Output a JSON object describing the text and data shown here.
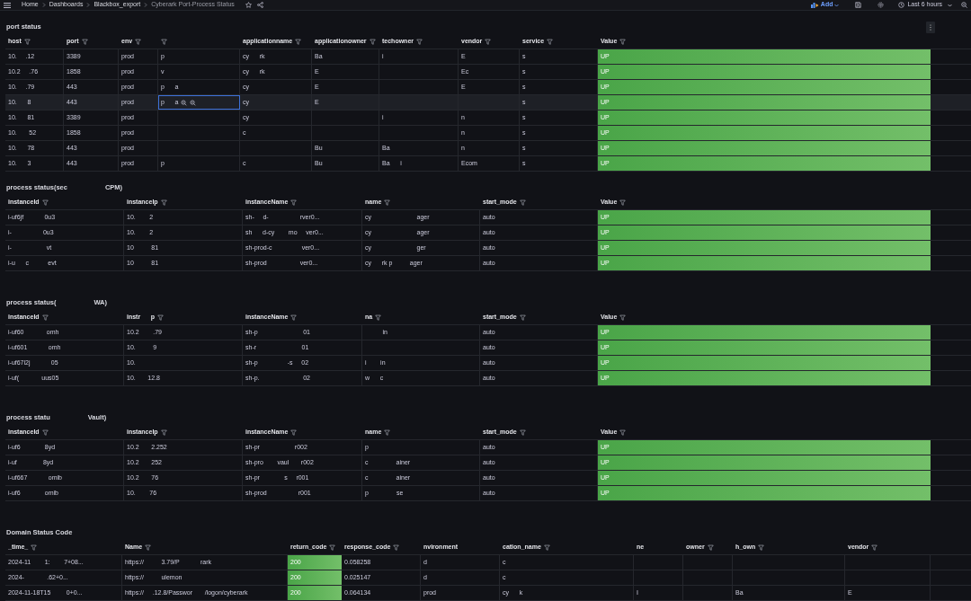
{
  "topbar": {
    "breadcrumbs": [
      "Home",
      "Dashboards",
      "Blackbox_export",
      "Cyberark Port-Process Status"
    ],
    "add_label": "Add",
    "time_range": "Last 6 hours"
  },
  "panels": [
    {
      "kind": "port",
      "title_parts": [
        "port status"
      ],
      "menu": true,
      "columns": [
        {
          "label": "host",
          "filter": true,
          "kind": "text"
        },
        {
          "label": "port",
          "filter": true,
          "kind": "text"
        },
        {
          "label": "env",
          "filter": true,
          "kind": "text"
        },
        {
          "filter": true,
          "kind": "text"
        },
        {
          "label": "applicationname",
          "filter": true,
          "kind": "text"
        },
        {
          "label": "applicationowner",
          "filter": true,
          "kind": "text"
        },
        {
          "label": "techowner",
          "filter": true,
          "kind": "text"
        },
        {
          "label": "vendor",
          "filter": true,
          "kind": "text"
        },
        {
          "label": "service",
          "filter": true,
          "kind": "text"
        },
        {
          "label": "Value",
          "filter": true,
          "kind": "status"
        }
      ],
      "rows": [
        {
          "highlighted": false,
          "cells": [
            "10.     .12",
            "3389",
            "prod",
            "p",
            "cy      rk",
            "Ba",
            "i",
            "E",
            "s",
            "UP"
          ]
        },
        {
          "highlighted": false,
          "cells": [
            "10.2     .76",
            "1858",
            "prod",
            "v",
            "cy      rk",
            "E",
            null,
            "Ec",
            "s",
            "UP"
          ]
        },
        {
          "highlighted": false,
          "cells": [
            "10.     .79",
            "443",
            "prod",
            "p      a",
            "cy",
            "E",
            null,
            "E",
            "s",
            "UP"
          ]
        },
        {
          "highlighted": true,
          "cells": [
            "10.      8",
            "443",
            "prod",
            "p      a",
            "cy",
            "E",
            null,
            null,
            "s",
            "UP"
          ]
        },
        {
          "highlighted": false,
          "cells": [
            "10.      81",
            "3389",
            "prod",
            null,
            "cy",
            null,
            "i",
            "n",
            "s",
            "UP"
          ]
        },
        {
          "highlighted": false,
          "cells": [
            "10.       52",
            "1858",
            "prod",
            null,
            "c",
            null,
            null,
            "n",
            "s",
            "UP"
          ]
        },
        {
          "highlighted": false,
          "cells": [
            "10.      78",
            "443",
            "prod",
            null,
            null,
            "Bu",
            "Ba",
            "n",
            "s",
            "UP"
          ]
        },
        {
          "highlighted": false,
          "cells": [
            "10.      3",
            "443",
            "prod",
            "p",
            "c",
            "Bu",
            "Ba      i",
            "Ecom",
            "s",
            "UP"
          ]
        }
      ]
    },
    {
      "kind": "process",
      "title_parts": [
        "process status(sec",
        "CPM)"
      ],
      "menu": false,
      "columns": [
        {
          "label": "instanceId",
          "filter": true,
          "kind": "text"
        },
        {
          "label": "instanceIp",
          "filter": true,
          "kind": "text"
        },
        {
          "label": "instanceName",
          "filter": true,
          "kind": "text"
        },
        {
          "label": "name",
          "filter": true,
          "kind": "text"
        },
        {
          "label": "start_mode",
          "filter": true,
          "kind": "text"
        },
        {
          "label": "Value",
          "filter": true,
          "kind": "status"
        }
      ],
      "rows": [
        {
          "highlighted": false,
          "cells": [
            "i-uf6jf            0u3",
            "10.        2",
            "sh-     d-                  rver0...",
            "cy                          ager",
            "auto",
            "UP"
          ]
        },
        {
          "highlighted": false,
          "cells": [
            "i-                  0u3",
            "10.        2",
            "sh      d-cy        mo     ver0...",
            "cy                          ager",
            "auto",
            "UP"
          ]
        },
        {
          "highlighted": false,
          "cells": [
            "i-                    vt",
            "10          81",
            "sh-prod-c                 ver0...",
            "cy                          ger",
            "auto",
            "UP"
          ]
        },
        {
          "highlighted": false,
          "cells": [
            "i-u      c           evt",
            "10          81",
            "sh-prod                   ver0...",
            "cy      rk p          ager",
            "auto",
            "UP"
          ]
        }
      ]
    },
    {
      "kind": "process",
      "title_parts": [
        "process status(",
        "WA)"
      ],
      "menu": false,
      "columns": [
        {
          "label": "instanceId",
          "filter": true,
          "kind": "text"
        },
        {
          "label": "instr      p",
          "filter": true,
          "kind": "text"
        },
        {
          "label": "instanceName",
          "filter": true,
          "kind": "text"
        },
        {
          "label": "na",
          "filter": true,
          "kind": "text"
        },
        {
          "label": "start_mode",
          "filter": true,
          "kind": "text"
        },
        {
          "label": "Value",
          "filter": true,
          "kind": "status"
        }
      ],
      "rows": [
        {
          "highlighted": false,
          "cells": [
            "i-uf60             omh",
            "10.2        .79",
            "sh-p                          01",
            "          in",
            "auto",
            "UP"
          ]
        },
        {
          "highlighted": false,
          "cells": [
            "i-uf601            omh",
            "10.          9",
            "sh-r                          01",
            null,
            "auto",
            "UP"
          ]
        },
        {
          "highlighted": false,
          "cells": [
            "i-uf67l2j            05",
            "10.",
            "sh-p                 -s     02",
            "i        in",
            "auto",
            "UP"
          ]
        },
        {
          "highlighted": false,
          "cells": [
            "i-uf(             uus05",
            "10.       12.8",
            "sh-p.                         02",
            "w      c",
            "auto",
            "UP"
          ]
        }
      ]
    },
    {
      "kind": "process",
      "title_parts": [
        "process statu",
        "Vault)"
      ],
      "menu": false,
      "columns": [
        {
          "label": "instanceId",
          "filter": true,
          "kind": "text"
        },
        {
          "label": "instanceIp",
          "filter": true,
          "kind": "text"
        },
        {
          "label": "instanceName",
          "filter": true,
          "kind": "text"
        },
        {
          "label": "name",
          "filter": true,
          "kind": "text"
        },
        {
          "label": "start_mode",
          "filter": true,
          "kind": "text"
        },
        {
          "label": "Value",
          "filter": true,
          "kind": "status"
        }
      ],
      "rows": [
        {
          "highlighted": false,
          "cells": [
            "i-uf6              8yd",
            "10.2       2.252",
            "sh-pr                    r002",
            "p",
            "auto",
            "UP"
          ]
        },
        {
          "highlighted": false,
          "cells": [
            "i-uf               8yd",
            "10.2       252",
            "sh-pro        vaul       r002",
            "c                ainer",
            "auto",
            "UP"
          ]
        },
        {
          "highlighted": false,
          "cells": [
            "i-uf667            omib",
            "10.2       76",
            "sh-pr              s     r001",
            "c                ainer",
            "auto",
            "UP"
          ]
        },
        {
          "highlighted": false,
          "cells": [
            "i-uf6              omib",
            "10.        76",
            "sh-prod                  r001",
            "p                se",
            "auto",
            "UP"
          ]
        }
      ]
    },
    {
      "kind": "domain",
      "title_parts": [
        "Domain Status Code"
      ],
      "menu": false,
      "columns": [
        {
          "label": "_time_",
          "filter": true,
          "kind": "text"
        },
        {
          "label": "Name",
          "filter": true,
          "kind": "text"
        },
        {
          "label": "return_code",
          "filter": true,
          "kind": "status"
        },
        {
          "label": "response_code",
          "filter": true,
          "kind": "text"
        },
        {
          "label": "nvironment",
          "filter": false,
          "kind": "text"
        },
        {
          "label": "cation_name",
          "filter": true,
          "kind": "text"
        },
        {
          "label": "ne",
          "filter": false,
          "kind": "text"
        },
        {
          "label": "owner",
          "filter": true,
          "kind": "text"
        },
        {
          "label": "h_own",
          "filter": true,
          "kind": "text"
        },
        {
          "label": "vendor",
          "filter": true,
          "kind": "text"
        }
      ],
      "rows": [
        {
          "highlighted": false,
          "cells": [
            "2024-11        1:        7+08...",
            "https://          3.79/P            rark",
            "200",
            "0.058258",
            "d",
            "c",
            null,
            null,
            null,
            null
          ]
        },
        {
          "highlighted": false,
          "cells": [
            "2024-             .62+0...",
            "https://          ulemon",
            "200",
            "0.025147",
            "d",
            "c",
            null,
            null,
            null,
            null
          ]
        },
        {
          "highlighted": false,
          "cells": [
            "2024-11-18T15         0+0...",
            "https://     .12.8/Passwor       /logon/cyberark",
            "200",
            "0.064134",
            "prod",
            "cy      k",
            "I",
            null,
            "Ba",
            "E"
          ]
        }
      ]
    }
  ]
}
